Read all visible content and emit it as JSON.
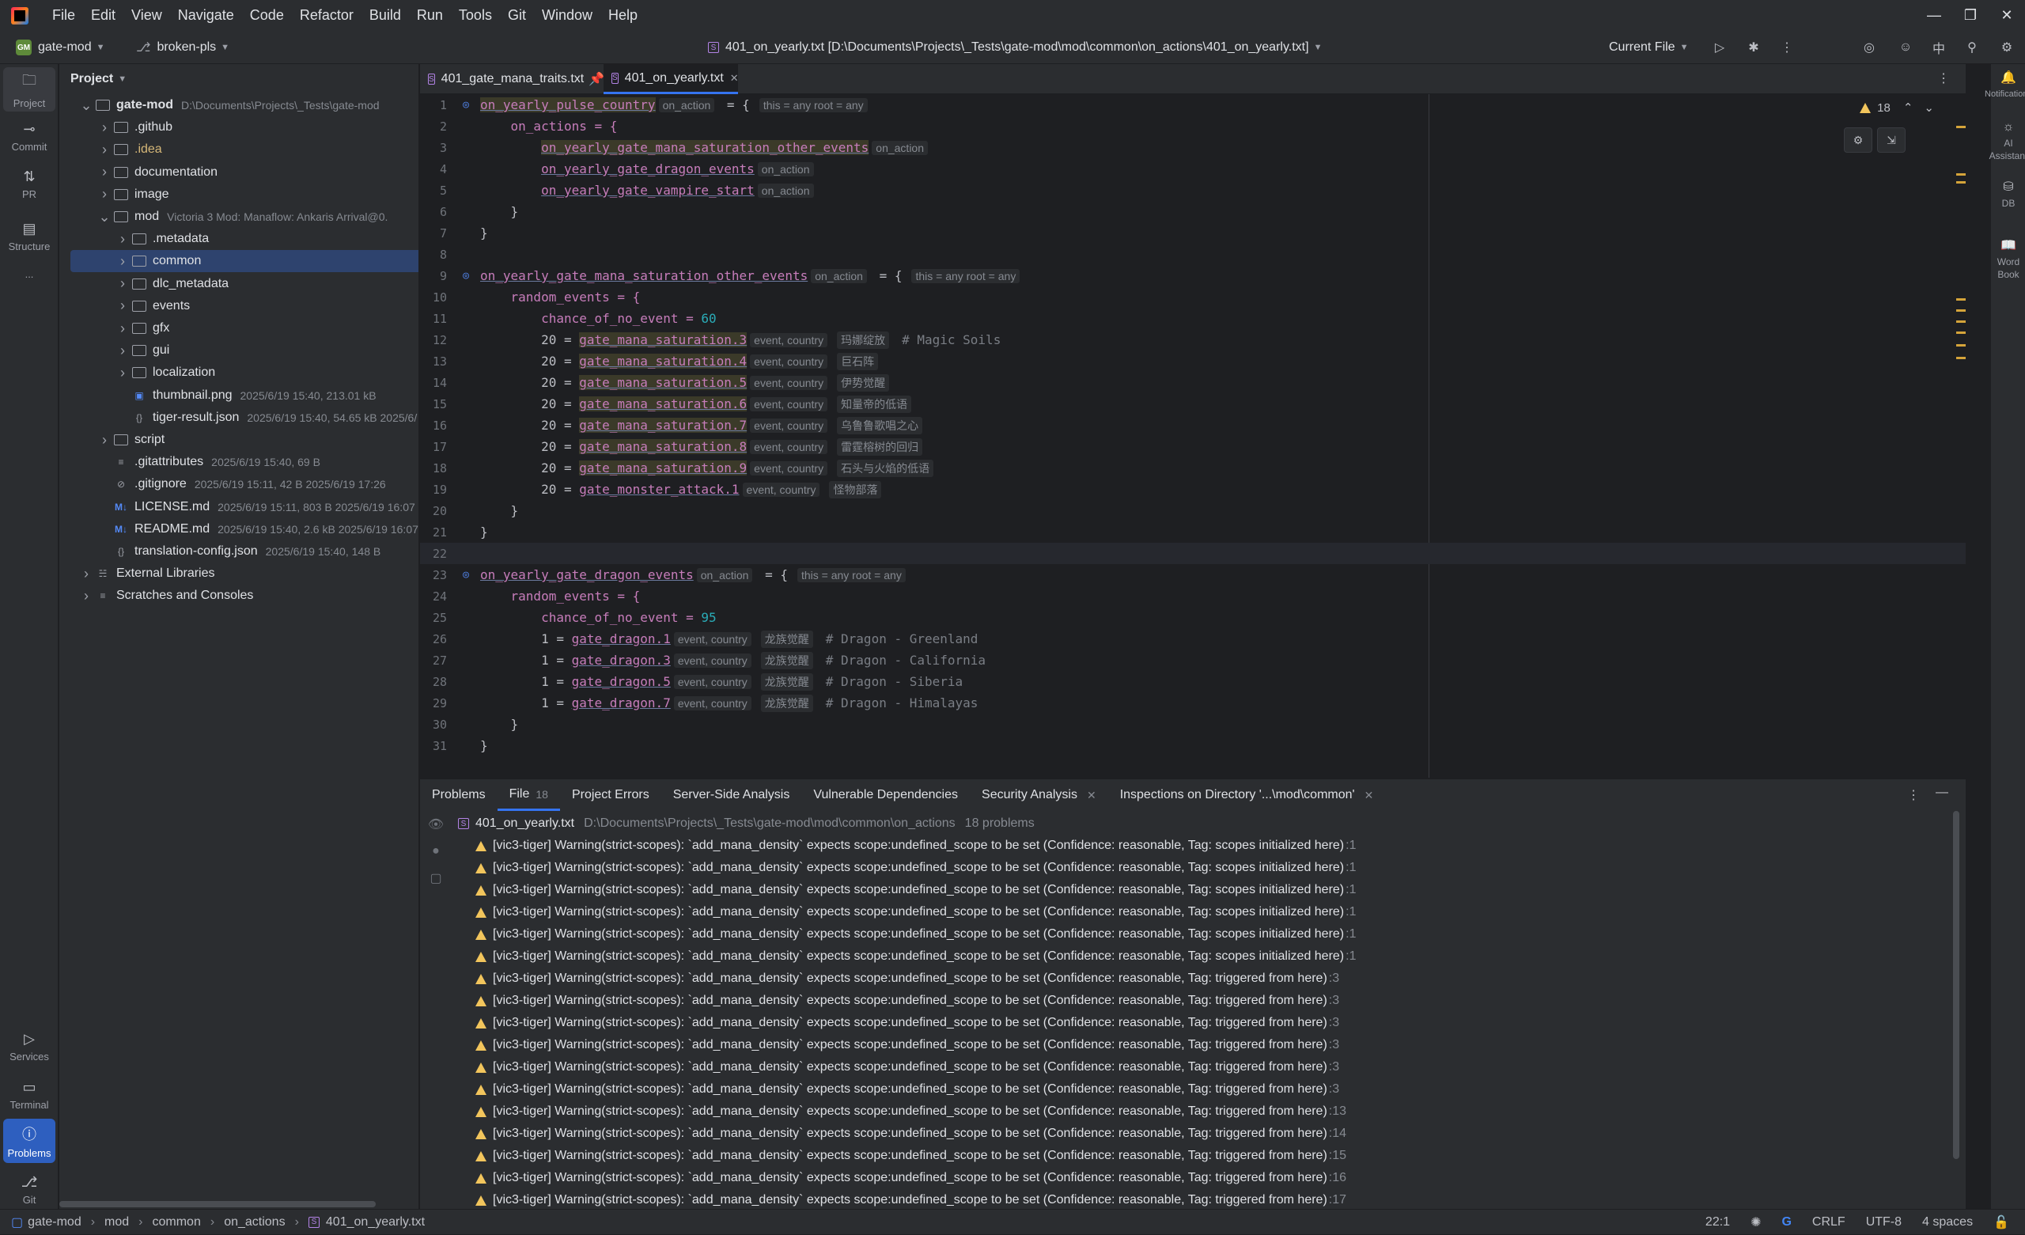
{
  "menu": [
    "File",
    "Edit",
    "View",
    "Navigate",
    "Code",
    "Refactor",
    "Build",
    "Run",
    "Tools",
    "Git",
    "Window",
    "Help"
  ],
  "toolbar": {
    "project_badge": "GM",
    "project": "gate-mod",
    "branch": "broken-pls",
    "window_title": "401_on_yearly.txt [D:\\Documents\\Projects\\_Tests\\gate-mod\\mod\\common\\on_actions\\401_on_yearly.txt]",
    "run_config": "Current File"
  },
  "leftbar": [
    "Project",
    "Commit",
    "PR",
    "Structure",
    "...",
    "Services",
    "Terminal",
    "Problems",
    "Git"
  ],
  "rightbar": [
    "Notifications",
    "AI Assistant",
    "DB",
    "Word Book"
  ],
  "project_panel": {
    "title": "Project",
    "rows": [
      {
        "name": "gate-mod",
        "meta": "D:\\Documents\\Projects\\_Tests\\gate-mod",
        "bold": true
      },
      {
        "name": ".github",
        "meta": ""
      },
      {
        "name": ".idea",
        "meta": ""
      },
      {
        "name": "documentation",
        "meta": ""
      },
      {
        "name": "image",
        "meta": ""
      },
      {
        "name": "mod",
        "meta": "Victoria 3 Mod: Manaflow: Ankaris Arrival@0."
      },
      {
        "name": ".metadata",
        "meta": ""
      },
      {
        "name": "common",
        "meta": ""
      },
      {
        "name": "dlc_metadata",
        "meta": ""
      },
      {
        "name": "events",
        "meta": ""
      },
      {
        "name": "gfx",
        "meta": ""
      },
      {
        "name": "gui",
        "meta": ""
      },
      {
        "name": "localization",
        "meta": ""
      },
      {
        "name": "thumbnail.png",
        "meta": "2025/6/19 15:40, 213.01 kB"
      },
      {
        "name": "tiger-result.json",
        "meta": "2025/6/19 15:40, 54.65 kB 2025/6/"
      },
      {
        "name": "script",
        "meta": ""
      },
      {
        "name": ".gitattributes",
        "meta": "2025/6/19 15:40, 69 B"
      },
      {
        "name": ".gitignore",
        "meta": "2025/6/19 15:11, 42 B 2025/6/19 17:26"
      },
      {
        "name": "LICENSE.md",
        "meta": "2025/6/19 15:11, 803 B 2025/6/19 16:07"
      },
      {
        "name": "README.md",
        "meta": "2025/6/19 15:40, 2.6 kB 2025/6/19 16:07"
      },
      {
        "name": "translation-config.json",
        "meta": "2025/6/19 15:40, 148 B"
      },
      {
        "name": "External Libraries",
        "meta": ""
      },
      {
        "name": "Scratches and Consoles",
        "meta": ""
      }
    ]
  },
  "tabs": [
    {
      "label": "401_gate_mana_traits.txt",
      "pinned": true
    },
    {
      "label": "401_on_yearly.txt",
      "active": true
    }
  ],
  "editor": {
    "warnings": "18",
    "hint_on_action": "on_action",
    "hint_scope": "this = any root = any",
    "hint_event": "event, country",
    "lines": [
      {
        "n": "1",
        "ind": 0,
        "t": "on_yearly_pulse_country",
        "cls": "ev hl",
        "after": " = {",
        "h1": "on_action",
        "h2": "this = any root = any"
      },
      {
        "n": "2",
        "ind": 1,
        "t": "on_actions = {",
        "cls": "kw"
      },
      {
        "n": "3",
        "ind": 2,
        "t": "on_yearly_gate_mana_saturation_other_events",
        "cls": "ev hl",
        "h1": "on_action"
      },
      {
        "n": "4",
        "ind": 2,
        "t": "on_yearly_gate_dragon_events",
        "cls": "ev",
        "h1": "on_action"
      },
      {
        "n": "5",
        "ind": 2,
        "t": "on_yearly_gate_vampire_start",
        "cls": "ev",
        "h1": "on_action"
      },
      {
        "n": "6",
        "ind": 1,
        "t": "}",
        "cls": "plain"
      },
      {
        "n": "7",
        "ind": 0,
        "t": "}",
        "cls": "plain"
      },
      {
        "n": "8",
        "ind": 0,
        "t": "",
        "cls": "plain"
      },
      {
        "n": "9",
        "ind": 0,
        "t": "on_yearly_gate_mana_saturation_other_events",
        "cls": "ev",
        "after": " = {",
        "h1": "on_action",
        "h2": "this = any root = any"
      },
      {
        "n": "10",
        "ind": 1,
        "t": "random_events = {",
        "cls": "kw"
      },
      {
        "n": "11",
        "ind": 2,
        "t": "chance_of_no_event = ",
        "cls": "kw",
        "num": "60"
      },
      {
        "n": "12",
        "ind": 2,
        "pre": "20 = ",
        "t": "gate_mana_saturation.3",
        "cls": "ev hl",
        "h1": "event, country",
        "h2": "玛娜绽放",
        "cmt": "# Magic Soils"
      },
      {
        "n": "13",
        "ind": 2,
        "pre": "20 = ",
        "t": "gate_mana_saturation.4",
        "cls": "ev hl",
        "h1": "event, country",
        "h2": "巨石阵"
      },
      {
        "n": "14",
        "ind": 2,
        "pre": "20 = ",
        "t": "gate_mana_saturation.5",
        "cls": "ev hl",
        "h1": "event, country",
        "h2": "伊势觉醒"
      },
      {
        "n": "15",
        "ind": 2,
        "pre": "20 = ",
        "t": "gate_mana_saturation.6",
        "cls": "ev hl",
        "h1": "event, country",
        "h2": "知量帝的低语"
      },
      {
        "n": "16",
        "ind": 2,
        "pre": "20 = ",
        "t": "gate_mana_saturation.7",
        "cls": "ev hl",
        "h1": "event, country",
        "h2": "乌鲁鲁歌唱之心"
      },
      {
        "n": "17",
        "ind": 2,
        "pre": "20 = ",
        "t": "gate_mana_saturation.8",
        "cls": "ev hl",
        "h1": "event, country",
        "h2": "雷霆榕树的回归"
      },
      {
        "n": "18",
        "ind": 2,
        "pre": "20 = ",
        "t": "gate_mana_saturation.9",
        "cls": "ev hl",
        "h1": "event, country",
        "h2": "石头与火焰的低语"
      },
      {
        "n": "19",
        "ind": 2,
        "pre": "20 = ",
        "t": "gate_monster_attack.1",
        "cls": "ev",
        "h1": "event, country",
        "h2": "怪物部落"
      },
      {
        "n": "20",
        "ind": 1,
        "t": "}",
        "cls": "plain"
      },
      {
        "n": "21",
        "ind": 0,
        "t": "}",
        "cls": "plain"
      },
      {
        "n": "22",
        "ind": 0,
        "t": "",
        "cls": "plain",
        "cur": true
      },
      {
        "n": "23",
        "ind": 0,
        "t": "on_yearly_gate_dragon_events",
        "cls": "ev",
        "after": " = {",
        "h1": "on_action",
        "h2": "this = any root = any"
      },
      {
        "n": "24",
        "ind": 1,
        "t": "random_events = {",
        "cls": "kw"
      },
      {
        "n": "25",
        "ind": 2,
        "t": "chance_of_no_event = ",
        "cls": "kw",
        "num": "95"
      },
      {
        "n": "26",
        "ind": 2,
        "pre": "1 = ",
        "t": "gate_dragon.1",
        "cls": "ev",
        "h1": "event, country",
        "h2": "龙族觉醒",
        "cmt": "# Dragon - Greenland"
      },
      {
        "n": "27",
        "ind": 2,
        "pre": "1 = ",
        "t": "gate_dragon.3",
        "cls": "ev",
        "h1": "event, country",
        "h2": "龙族觉醒",
        "cmt": "# Dragon - California"
      },
      {
        "n": "28",
        "ind": 2,
        "pre": "1 = ",
        "t": "gate_dragon.5",
        "cls": "ev",
        "h1": "event, country",
        "h2": "龙族觉醒",
        "cmt": "# Dragon - Siberia"
      },
      {
        "n": "29",
        "ind": 2,
        "pre": "1 = ",
        "t": "gate_dragon.7",
        "cls": "ev",
        "h1": "event, country",
        "h2": "龙族觉醒",
        "cmt": "# Dragon - Himalayas"
      },
      {
        "n": "30",
        "ind": 1,
        "t": "}",
        "cls": "plain"
      },
      {
        "n": "31",
        "ind": 0,
        "t": "}",
        "cls": "plain"
      }
    ]
  },
  "problems": {
    "tabs": [
      {
        "label": "Problems",
        "active_plain": true
      },
      {
        "label": "File",
        "count": "18",
        "active": true
      },
      {
        "label": "Project Errors"
      },
      {
        "label": "Server-Side Analysis"
      },
      {
        "label": "Vulnerable Dependencies"
      },
      {
        "label": "Security Analysis",
        "closable": true
      },
      {
        "label": "Inspections on Directory '...\\mod\\common'",
        "closable": true
      }
    ],
    "file": "401_on_yearly.txt",
    "file_path": "D:\\Documents\\Projects\\_Tests\\gate-mod\\mod\\common\\on_actions",
    "file_count": "18 problems",
    "rows": [
      {
        "msg": "[vic3-tiger] Warning(strict-scopes): `add_mana_density` expects scope:undefined_scope to be set (Confidence: reasonable, Tag: scopes initialized here)",
        "line": ":1"
      },
      {
        "msg": "[vic3-tiger] Warning(strict-scopes): `add_mana_density` expects scope:undefined_scope to be set (Confidence: reasonable, Tag: scopes initialized here)",
        "line": ":1"
      },
      {
        "msg": "[vic3-tiger] Warning(strict-scopes): `add_mana_density` expects scope:undefined_scope to be set (Confidence: reasonable, Tag: scopes initialized here)",
        "line": ":1"
      },
      {
        "msg": "[vic3-tiger] Warning(strict-scopes): `add_mana_density` expects scope:undefined_scope to be set (Confidence: reasonable, Tag: scopes initialized here)",
        "line": ":1"
      },
      {
        "msg": "[vic3-tiger] Warning(strict-scopes): `add_mana_density` expects scope:undefined_scope to be set (Confidence: reasonable, Tag: scopes initialized here)",
        "line": ":1"
      },
      {
        "msg": "[vic3-tiger] Warning(strict-scopes): `add_mana_density` expects scope:undefined_scope to be set (Confidence: reasonable, Tag: scopes initialized here)",
        "line": ":1"
      },
      {
        "msg": "[vic3-tiger] Warning(strict-scopes): `add_mana_density` expects scope:undefined_scope to be set (Confidence: reasonable, Tag: triggered from here)",
        "line": ":3"
      },
      {
        "msg": "[vic3-tiger] Warning(strict-scopes): `add_mana_density` expects scope:undefined_scope to be set (Confidence: reasonable, Tag: triggered from here)",
        "line": ":3"
      },
      {
        "msg": "[vic3-tiger] Warning(strict-scopes): `add_mana_density` expects scope:undefined_scope to be set (Confidence: reasonable, Tag: triggered from here)",
        "line": ":3"
      },
      {
        "msg": "[vic3-tiger] Warning(strict-scopes): `add_mana_density` expects scope:undefined_scope to be set (Confidence: reasonable, Tag: triggered from here)",
        "line": ":3"
      },
      {
        "msg": "[vic3-tiger] Warning(strict-scopes): `add_mana_density` expects scope:undefined_scope to be set (Confidence: reasonable, Tag: triggered from here)",
        "line": ":3"
      },
      {
        "msg": "[vic3-tiger] Warning(strict-scopes): `add_mana_density` expects scope:undefined_scope to be set (Confidence: reasonable, Tag: triggered from here)",
        "line": ":3"
      },
      {
        "msg": "[vic3-tiger] Warning(strict-scopes): `add_mana_density` expects scope:undefined_scope to be set (Confidence: reasonable, Tag: triggered from here)",
        "line": ":13"
      },
      {
        "msg": "[vic3-tiger] Warning(strict-scopes): `add_mana_density` expects scope:undefined_scope to be set (Confidence: reasonable, Tag: triggered from here)",
        "line": ":14"
      },
      {
        "msg": "[vic3-tiger] Warning(strict-scopes): `add_mana_density` expects scope:undefined_scope to be set (Confidence: reasonable, Tag: triggered from here)",
        "line": ":15"
      },
      {
        "msg": "[vic3-tiger] Warning(strict-scopes): `add_mana_density` expects scope:undefined_scope to be set (Confidence: reasonable, Tag: triggered from here)",
        "line": ":16"
      },
      {
        "msg": "[vic3-tiger] Warning(strict-scopes): `add_mana_density` expects scope:undefined_scope to be set (Confidence: reasonable, Tag: triggered from here)",
        "line": ":17"
      }
    ]
  },
  "status": {
    "breadcrumb": [
      "gate-mod",
      "mod",
      "common",
      "on_actions",
      "401_on_yearly.txt"
    ],
    "position": "22:1",
    "line_sep": "CRLF",
    "encoding": "UTF-8",
    "indent": "4 spaces"
  },
  "colors": {
    "accent": "#3574f0",
    "warning": "#f2c55c",
    "event": "#c77dbb",
    "number": "#2aacb8"
  }
}
